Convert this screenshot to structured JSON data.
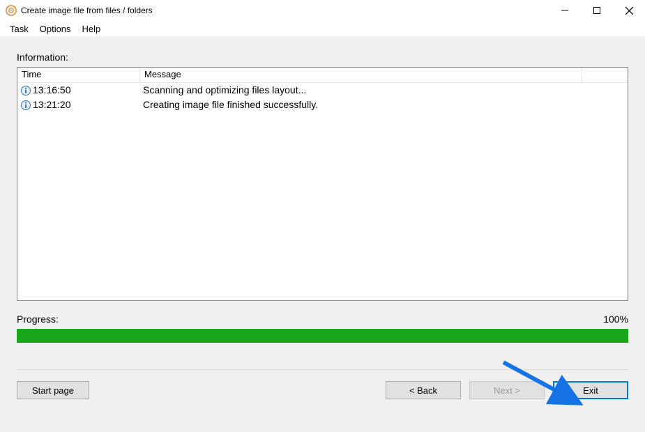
{
  "window": {
    "title": "Create image file from files / folders"
  },
  "menu": {
    "items": [
      "Task",
      "Options",
      "Help"
    ]
  },
  "info_label": "Information:",
  "log": {
    "columns": {
      "time": "Time",
      "message": "Message"
    },
    "rows": [
      {
        "time": "13:16:50",
        "message": "Scanning and optimizing files layout..."
      },
      {
        "time": "13:21:20",
        "message": "Creating image file finished successfully."
      }
    ]
  },
  "progress": {
    "label": "Progress:",
    "percent_text": "100%",
    "percent": 100
  },
  "buttons": {
    "start_page": "Start page",
    "back": "< Back",
    "next": "Next >",
    "exit": "Exit"
  }
}
